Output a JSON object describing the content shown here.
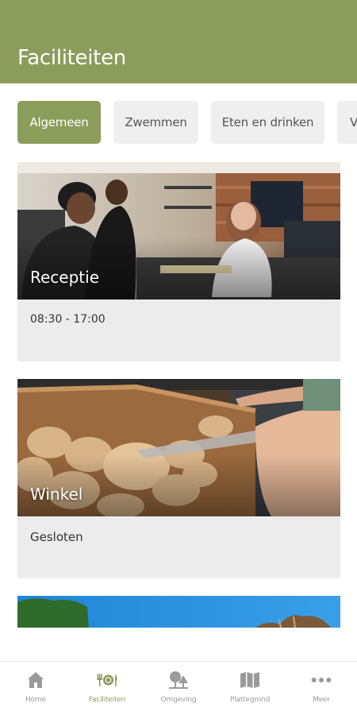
{
  "header": {
    "title": "Faciliteiten"
  },
  "tabs": [
    {
      "label": "Algemeen",
      "active": true
    },
    {
      "label": "Zwemmen",
      "active": false
    },
    {
      "label": "Eten en drinken",
      "active": false
    },
    {
      "label": "V",
      "active": false
    }
  ],
  "cards": [
    {
      "title": "Receptie",
      "text": "08:30 - 17:00",
      "image": "reception-desk-photo"
    },
    {
      "title": "Winkel",
      "text": "Gesloten",
      "image": "bread-basket-photo"
    },
    {
      "title": "",
      "text": "",
      "image": "pool-landscape-photo"
    }
  ],
  "nav": [
    {
      "label": "Home",
      "icon": "home-icon",
      "active": false
    },
    {
      "label": "Faciliteiten",
      "icon": "cutlery-icon",
      "active": true
    },
    {
      "label": "Omgeving",
      "icon": "trees-icon",
      "active": false
    },
    {
      "label": "Plattegrond",
      "icon": "map-icon",
      "active": false
    },
    {
      "label": "Meer",
      "icon": "more-icon",
      "active": false
    }
  ],
  "colors": {
    "accent": "#8c9c5b",
    "tab_bg": "#efefef",
    "card_bg": "#ececec",
    "inactive": "#9a9a9a"
  }
}
